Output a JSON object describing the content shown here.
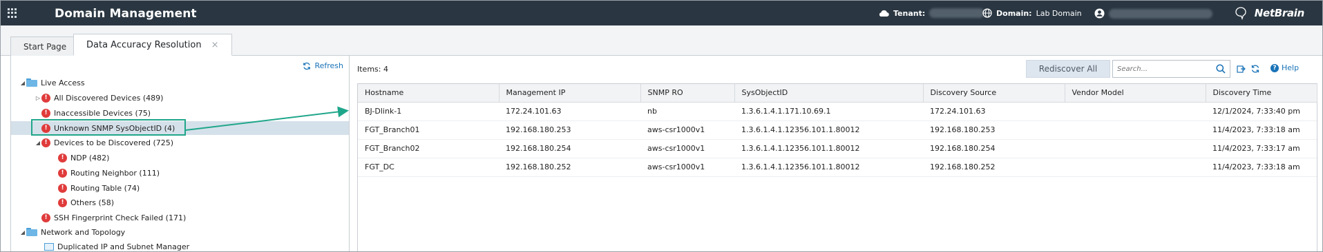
{
  "header": {
    "title": "Domain Management",
    "tenant_label": "Tenant:",
    "domain_label": "Domain:",
    "domain_value": "Lab Domain",
    "logo_text": "NetBrain"
  },
  "tabs": [
    {
      "label": "Start Page"
    },
    {
      "label": "Data Accuracy Resolution",
      "close": "×"
    }
  ],
  "left_panel": {
    "refresh_label": "Refresh",
    "tree": [
      {
        "label": "Live Access"
      },
      {
        "label": "All Discovered Devices (489)"
      },
      {
        "label": "Inaccessible Devices (75)"
      },
      {
        "label": "Unknown SNMP SysObjectID (4)"
      },
      {
        "label": "Devices to be Discovered (725)"
      },
      {
        "label": "NDP (482)"
      },
      {
        "label": "Routing Neighbor (111)"
      },
      {
        "label": "Routing Table (74)"
      },
      {
        "label": "Others (58)"
      },
      {
        "label": "SSH Fingerprint Check Failed (171)"
      },
      {
        "label": "Network and Topology"
      },
      {
        "label": "Duplicated IP and Subnet Manager"
      }
    ]
  },
  "right_panel": {
    "items_label": "Items: 4",
    "rediscover_label": "Rediscover All",
    "search_placeholder": "Search...",
    "help_label": "Help",
    "columns": [
      "Hostname",
      "Management IP",
      "SNMP RO",
      "SysObjectID",
      "Discovery Source",
      "Vendor Model",
      "Discovery Time"
    ],
    "rows": [
      [
        "BJ-Dlink-1",
        "172.24.101.63",
        "nb",
        "1.3.6.1.4.1.171.10.69.1",
        "172.24.101.63",
        "",
        "12/1/2024, 7:33:40 pm"
      ],
      [
        "FGT_Branch01",
        "192.168.180.253",
        "aws-csr1000v1",
        "1.3.6.1.4.1.12356.101.1.80012",
        "192.168.180.253",
        "",
        "11/4/2023, 7:33:18 am"
      ],
      [
        "FGT_Branch02",
        "192.168.180.254",
        "aws-csr1000v1",
        "1.3.6.1.4.1.12356.101.1.80012",
        "192.168.180.254",
        "",
        "11/4/2023, 7:33:17 am"
      ],
      [
        "FGT_DC",
        "192.168.180.252",
        "aws-csr1000v1",
        "1.3.6.1.4.1.12356.101.1.80012",
        "192.168.180.252",
        "",
        "11/4/2023, 7:33:18 am"
      ]
    ]
  },
  "colors": {
    "header_bg": "#2a3742",
    "accent": "#1a73b8",
    "error": "#e03b3b",
    "highlight": "#1fa68a",
    "selection": "#d5e1ea"
  }
}
